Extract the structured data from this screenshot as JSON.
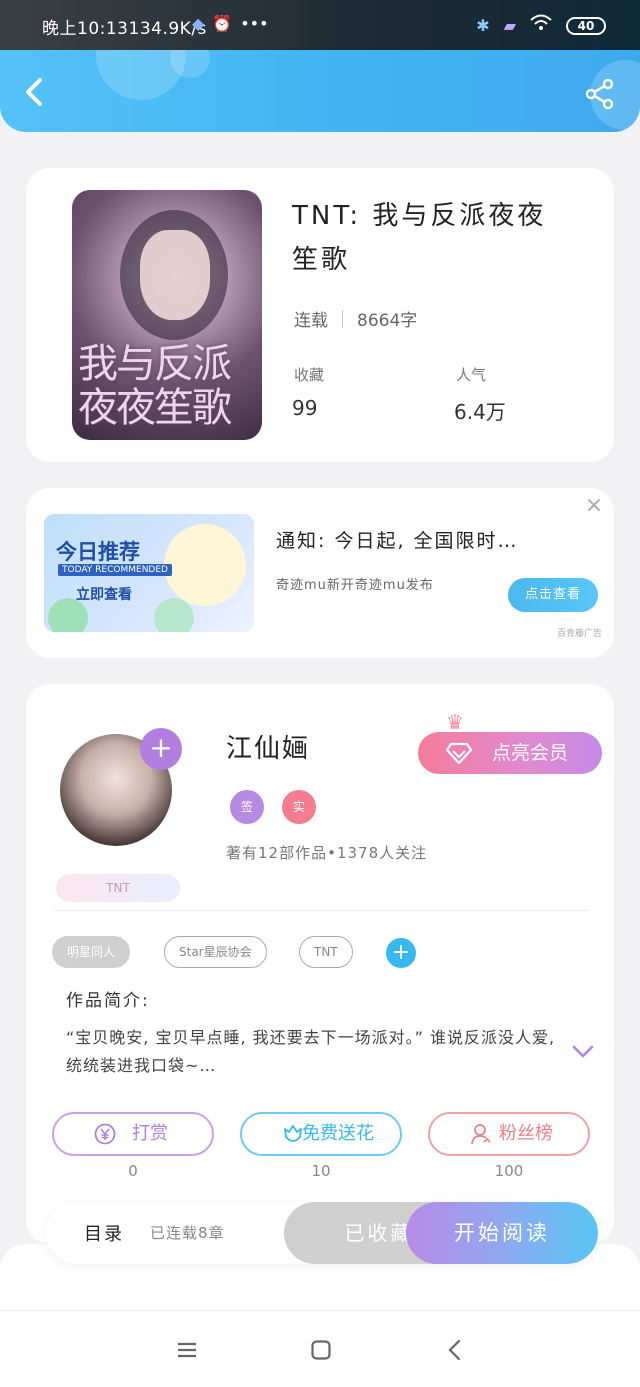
{
  "status_bar": {
    "time": "晚上10:13",
    "net_speed": "134.9K/s",
    "more": "•••",
    "battery": "40"
  },
  "book": {
    "title": "TNT: 我与反派夜夜笙歌",
    "cover_text": "我与反派夜夜笙歌",
    "status": "连载",
    "word_count": "8664字",
    "favorites_label": "收藏",
    "favorites_value": "99",
    "popularity_label": "人气",
    "popularity_value": "6.4万"
  },
  "ad": {
    "image_title": "今日推荐",
    "image_subtitle": "TODAY RECOMMENDED",
    "image_cta": "立即查看",
    "title": "通知: 今日起, 全国限时…",
    "desc": "奇迹mu新开奇迹mu发布",
    "button": "点击查看",
    "source": "百青藤广告"
  },
  "author": {
    "name": "江仙婳",
    "fan_tag": "TNT",
    "vip_button": "点亮会员",
    "badge_sign": "签",
    "badge_real": "实",
    "stats": "著有12部作品•1378人关注"
  },
  "tags": [
    "明星同人",
    "Star星辰协会",
    "TNT"
  ],
  "intro": {
    "heading": "作品简介:",
    "text": "“宝贝晚安, 宝贝早点睡, 我还要去下一场派对。” 谁说反派没人爱, 统统装进我口袋~…"
  },
  "actions": [
    {
      "label": "打赏",
      "count": "0"
    },
    {
      "label": "免费送花",
      "count": "10"
    },
    {
      "label": "粉丝榜",
      "count": "100"
    }
  ],
  "read_bar": {
    "toc": "目录",
    "chapters": "已连载8章",
    "collected": "已收藏",
    "start": "开始阅读"
  },
  "colors": {
    "header": "#42b5f2",
    "purple": "#b07fe0",
    "cyan": "#37b9ef",
    "pink": "#f57b9b"
  }
}
